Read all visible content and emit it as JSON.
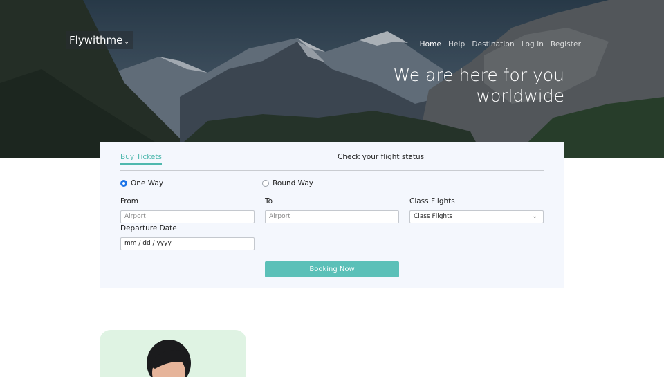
{
  "brand": {
    "logo_text": "Flywithme"
  },
  "nav": {
    "items": [
      "Home",
      "Help",
      "Destination",
      "Log in",
      "Register"
    ],
    "active": "Home"
  },
  "hero": {
    "headline_line1": "We are here for you",
    "headline_line2": "worldwide"
  },
  "booking": {
    "tabs": {
      "buy": "Buy Tickets",
      "status": "Check your flight status"
    },
    "trip_type": {
      "one_way": "One Way",
      "round_way": "Round Way",
      "selected": "One Way"
    },
    "from": {
      "label": "From",
      "placeholder": "Airport"
    },
    "to": {
      "label": "To",
      "placeholder": "Airport"
    },
    "class": {
      "label": "Class Flights",
      "value": "Class Flights"
    },
    "departure": {
      "label": "Departure Date",
      "value": "mm / dd / yyyy"
    },
    "submit_label": "Booking Now"
  },
  "colors": {
    "accent": "#5bc0b8",
    "tab_active": "#4fb8ae",
    "radio_selected": "#1a73e8",
    "card_bg": "#f4f7fd",
    "agent_card_bg": "#dff3e3"
  }
}
